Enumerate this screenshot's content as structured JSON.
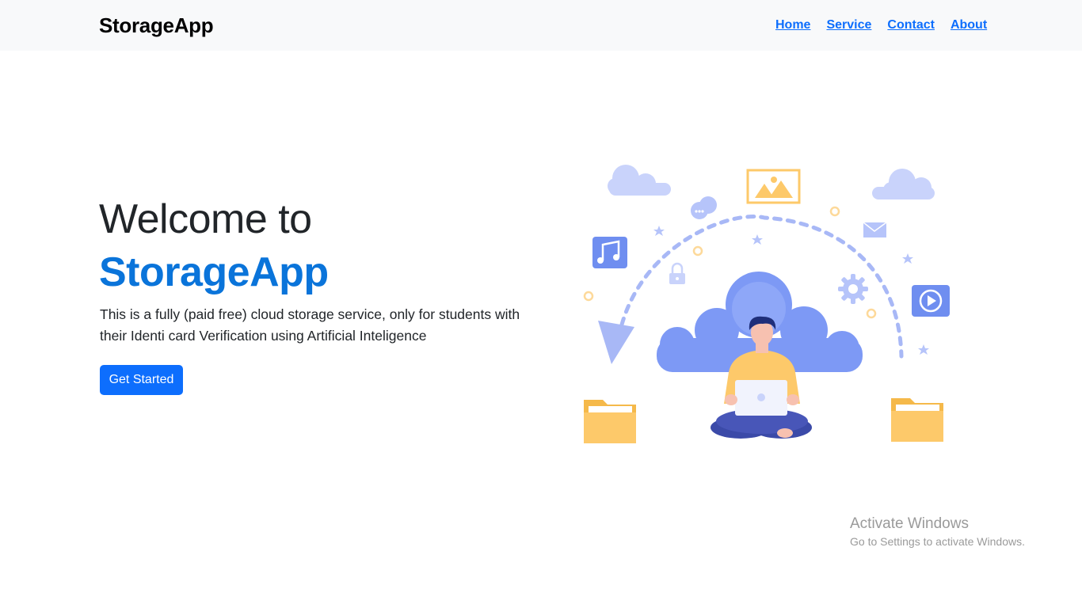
{
  "navbar": {
    "brand": "StorageApp",
    "links": [
      {
        "label": "Home"
      },
      {
        "label": "Service"
      },
      {
        "label": "Contact"
      },
      {
        "label": "About"
      }
    ]
  },
  "hero": {
    "title": "Welcome to",
    "brand": "StorageApp",
    "description": "This is a fully (paid free) cloud storage service, only for students with their Identi card Verification using Artificial Inteligence",
    "cta_label": "Get Started"
  },
  "illustration": {
    "icons": [
      "cloud-icon",
      "image-icon",
      "chat-icon",
      "mail-icon",
      "music-icon",
      "lock-icon",
      "gear-icon",
      "play-icon",
      "folder-icon",
      "star-icon",
      "arrow-icon",
      "laptop-icon"
    ]
  },
  "watermark": {
    "title": "Activate Windows",
    "subtitle": "Go to Settings to activate Windows."
  },
  "colors": {
    "accent": "#0d6efd",
    "brand_text": "#0a74da",
    "navbar_bg": "#f8f9fa",
    "illustration_blue": "#7d99f5",
    "illustration_yellow": "#fdc96a"
  }
}
